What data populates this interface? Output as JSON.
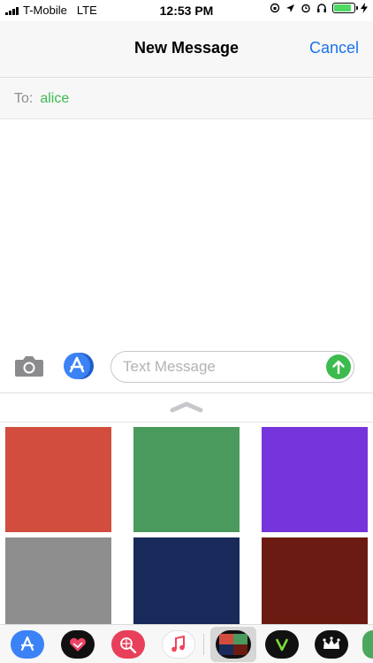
{
  "status_bar": {
    "carrier": "T-Mobile",
    "network": "LTE",
    "time": "12:53 PM",
    "battery_level": 0.85
  },
  "nav": {
    "title": "New Message",
    "cancel_label": "Cancel"
  },
  "recipient": {
    "label": "To:",
    "name": "alice"
  },
  "compose": {
    "placeholder": "Text Message",
    "value": ""
  },
  "color_tiles": [
    "#d24d3e",
    "#4a9a5d",
    "#7634db",
    "#8e8e8e",
    "#172a5a",
    "#6c1b12"
  ],
  "dock_apps": [
    "app-store-icon",
    "digital-touch-icon",
    "images-search-icon",
    "music-icon",
    "color-grid-app-icon",
    "v-app-icon",
    "crown-app-icon",
    "green-app-icon"
  ],
  "colors": {
    "accent_blue": "#1a73e8",
    "imessage_green": "#3dbb4f"
  }
}
